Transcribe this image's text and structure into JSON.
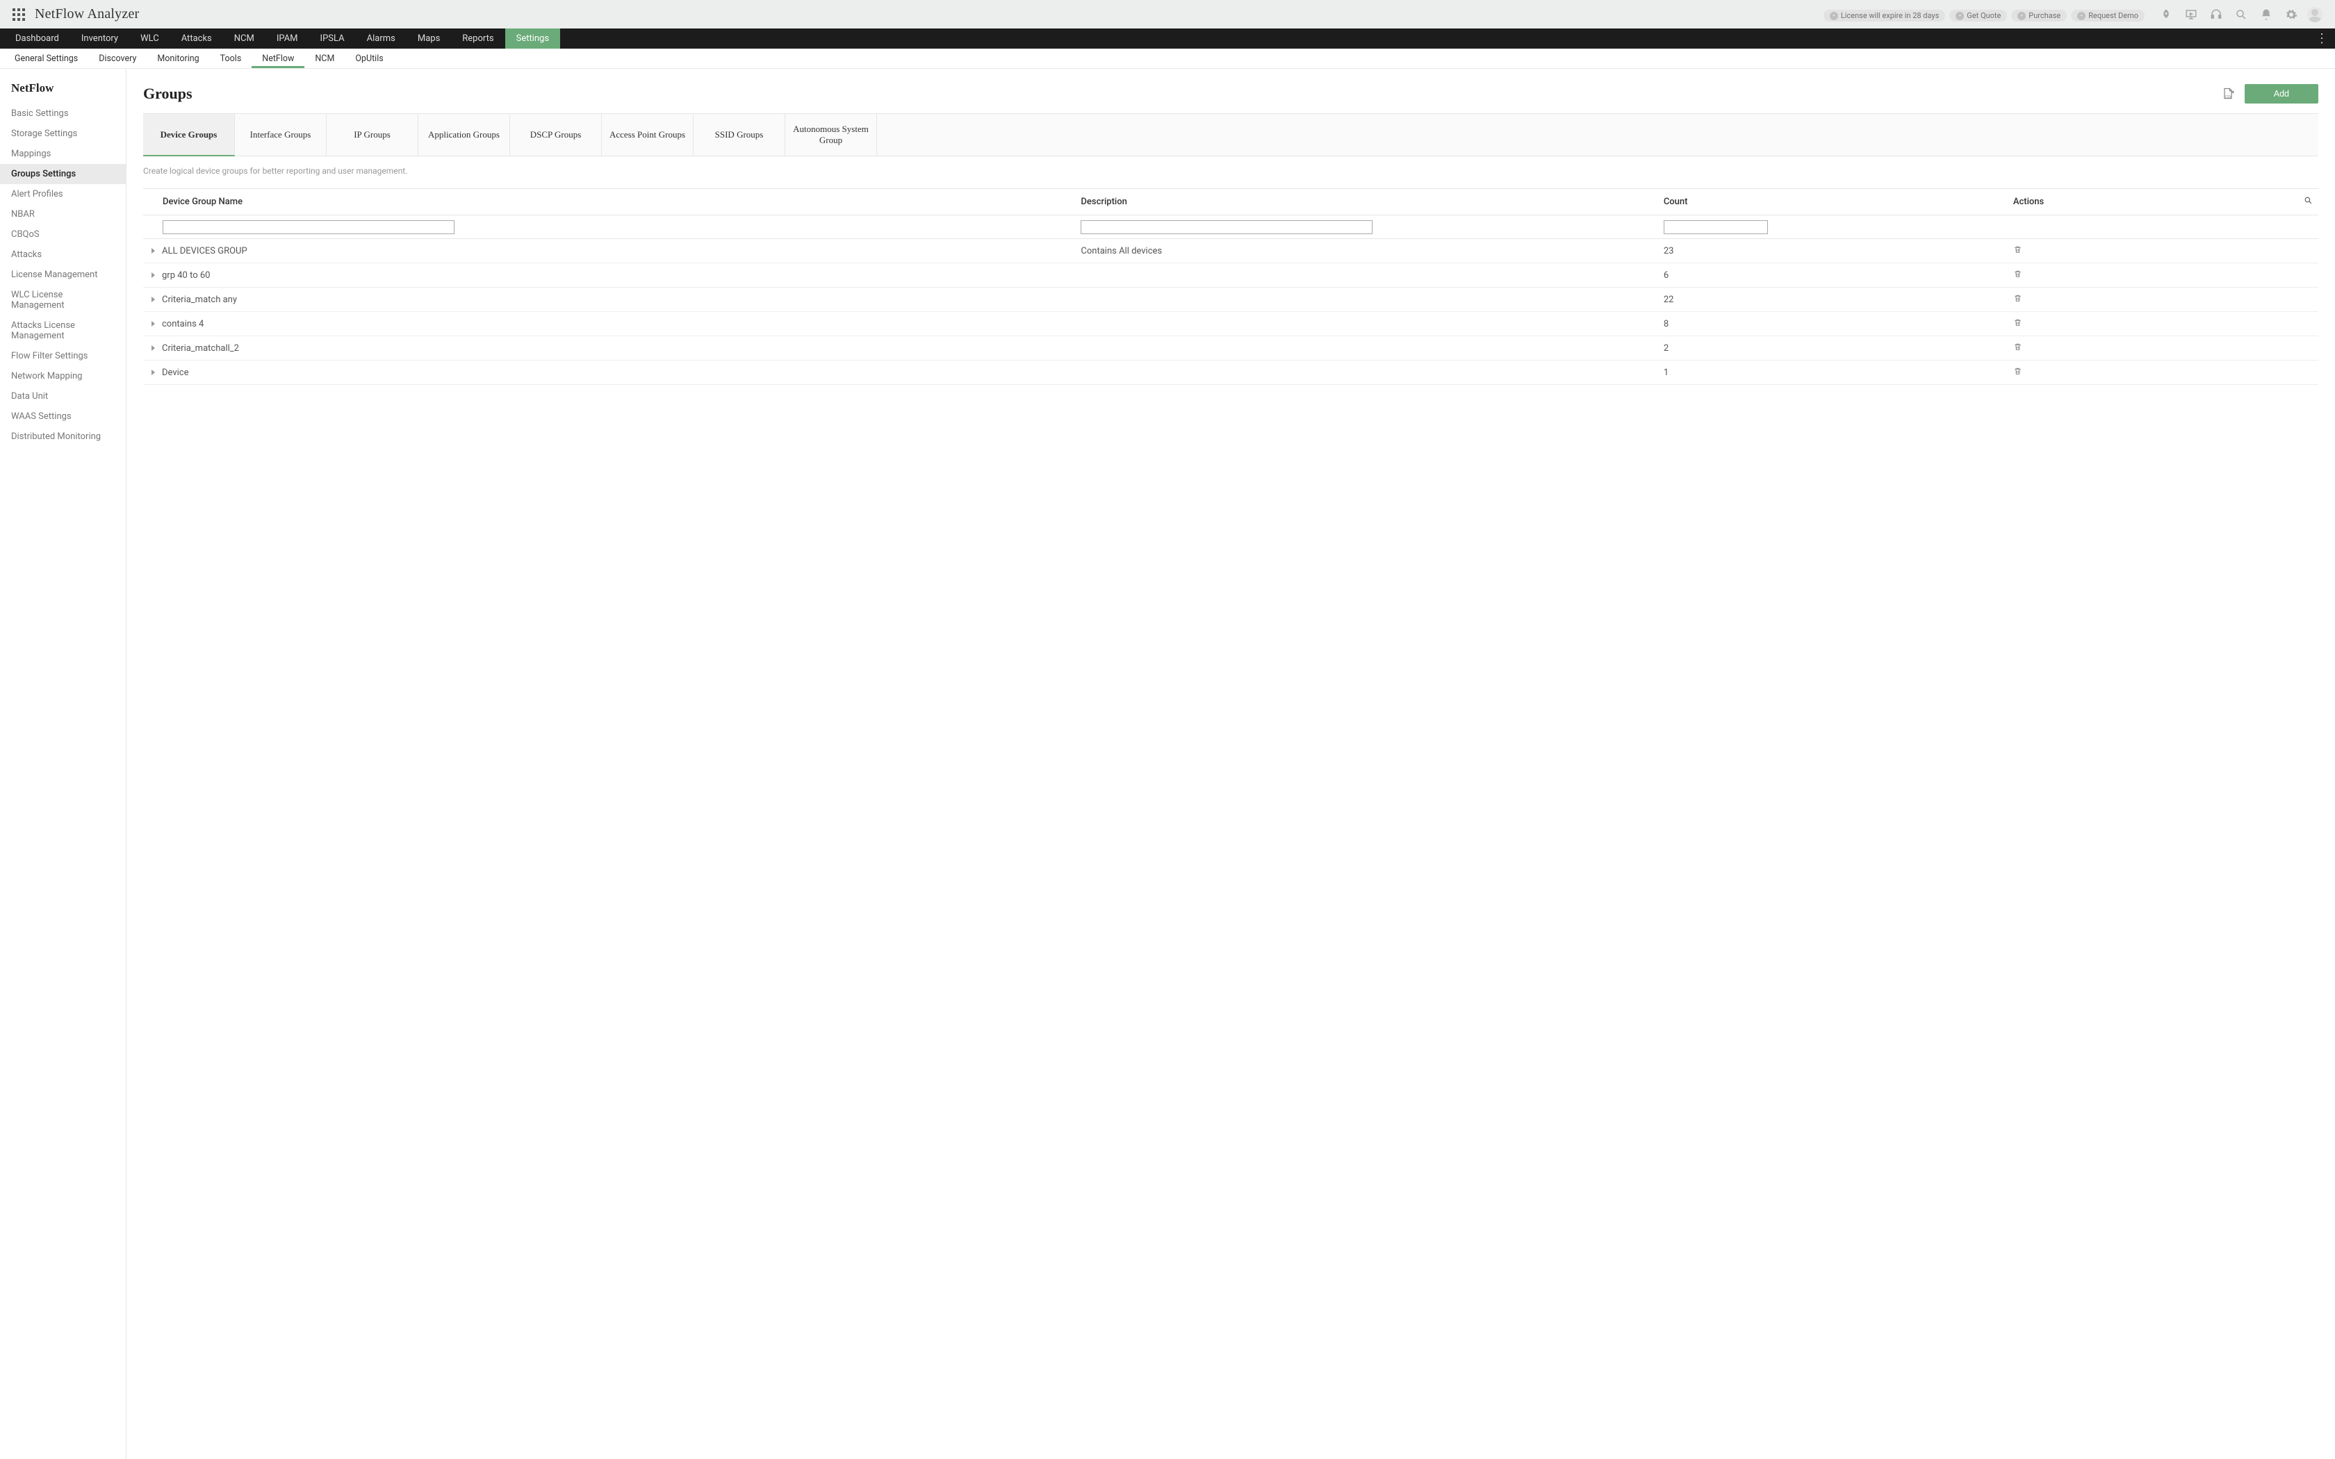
{
  "titlebar": {
    "product_name": "NetFlow Analyzer",
    "pills": [
      {
        "icon": "clock",
        "label": "License will expire in 28 days"
      },
      {
        "icon": "dollar",
        "label": "Get Quote"
      },
      {
        "icon": "cart",
        "label": "Purchase"
      },
      {
        "icon": "eye",
        "label": "Request Demo"
      }
    ]
  },
  "primary_nav": {
    "items": [
      "Dashboard",
      "Inventory",
      "WLC",
      "Attacks",
      "NCM",
      "IPAM",
      "IPSLA",
      "Alarms",
      "Maps",
      "Reports",
      "Settings"
    ],
    "active_index": 10
  },
  "secondary_nav": {
    "items": [
      "General Settings",
      "Discovery",
      "Monitoring",
      "Tools",
      "NetFlow",
      "NCM",
      "OpUtils"
    ],
    "active_index": 4
  },
  "sidebar": {
    "title": "NetFlow",
    "items": [
      "Basic Settings",
      "Storage Settings",
      "Mappings",
      "Groups Settings",
      "Alert Profiles",
      "NBAR",
      "CBQoS",
      "Attacks",
      "License Management",
      "WLC License Management",
      "Attacks License Management",
      "Flow Filter Settings",
      "Network Mapping",
      "Data Unit",
      "WAAS Settings",
      "Distributed Monitoring"
    ],
    "active_index": 3
  },
  "page": {
    "title": "Groups",
    "add_label": "Add",
    "subtitle": "Create logical device groups for better reporting and user management."
  },
  "group_tabs": {
    "items": [
      "Device Groups",
      "Interface Groups",
      "IP Groups",
      "Application Groups",
      "DSCP Groups",
      "Access Point Groups",
      "SSID Groups",
      "Autonomous System Group"
    ],
    "active_index": 0
  },
  "table": {
    "headers": {
      "name": "Device Group Name",
      "desc": "Description",
      "count": "Count",
      "actions": "Actions"
    },
    "rows": [
      {
        "name": "ALL DEVICES GROUP",
        "desc": "Contains All devices",
        "count": "23"
      },
      {
        "name": "grp 40 to 60",
        "desc": "",
        "count": "6"
      },
      {
        "name": "Criteria_match any",
        "desc": "",
        "count": "22"
      },
      {
        "name": "contains 4",
        "desc": "",
        "count": "8"
      },
      {
        "name": "Criteria_matchall_2",
        "desc": "",
        "count": "2"
      },
      {
        "name": "Device",
        "desc": "",
        "count": "1"
      }
    ]
  }
}
